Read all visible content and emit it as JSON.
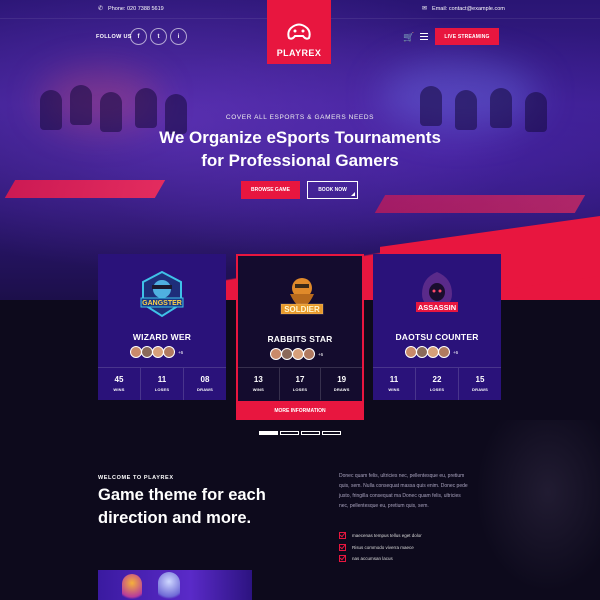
{
  "topbar": {
    "phone": "Phone: 020 7388 5619",
    "email": "Email: contact@example.com"
  },
  "nav": {
    "follow_label": "FOLLOW US",
    "social": [
      "f",
      "t",
      "i"
    ],
    "brand": "PLAYREX",
    "live_button": "LIVE STREAMING"
  },
  "hero": {
    "eyebrow": "COVER ALL ESPORTS & GAMERS NEEDS",
    "title_line1": "We Organize eSports Tournaments",
    "title_line2": "for Professional Gamers",
    "browse_button": "BROWSE GAME",
    "book_button": "BOOK NOW"
  },
  "teams": [
    {
      "name": "WIZARD WER",
      "emblem_text": "GANGSTER",
      "extra_members": "+6",
      "stats": [
        {
          "value": "45",
          "label": "WINS"
        },
        {
          "value": "11",
          "label": "LOSES"
        },
        {
          "value": "08",
          "label": "DRAWS"
        }
      ]
    },
    {
      "name": "RABBITS STAR",
      "emblem_text": "SOLDIER",
      "extra_members": "+6",
      "stats": [
        {
          "value": "13",
          "label": "WINS"
        },
        {
          "value": "17",
          "label": "LOSES"
        },
        {
          "value": "19",
          "label": "DRAWS"
        }
      ],
      "more_info": "MORE INFORMATION"
    },
    {
      "name": "DAOTSU COUNTER",
      "emblem_text": "ASSASSIN",
      "extra_members": "+6",
      "stats": [
        {
          "value": "11",
          "label": "WINS"
        },
        {
          "value": "22",
          "label": "LOSES"
        },
        {
          "value": "15",
          "label": "DRAWS"
        }
      ]
    }
  ],
  "welcome": {
    "eyebrow": "WELCOME TO PLAYREX",
    "title": "Game theme for each direction and more.",
    "paragraph": "Donec quam felis, ultricies nec, pellentesque eu, pretium quis, sem. Nulla consequat massa quis enim. Donec pede justo, fringilla consequat ma Donec quam felis, ultricies nec, pellentesque eu, pretium quis, sem.",
    "checks": [
      "maecenas tempus tellus eget dolor",
      "Risus commodo viverra maece",
      "nas accumsan lacus"
    ]
  },
  "colors": {
    "accent": "#e8163f",
    "card_bg": "#2a127a",
    "page_bg": "#0d0a1c"
  }
}
